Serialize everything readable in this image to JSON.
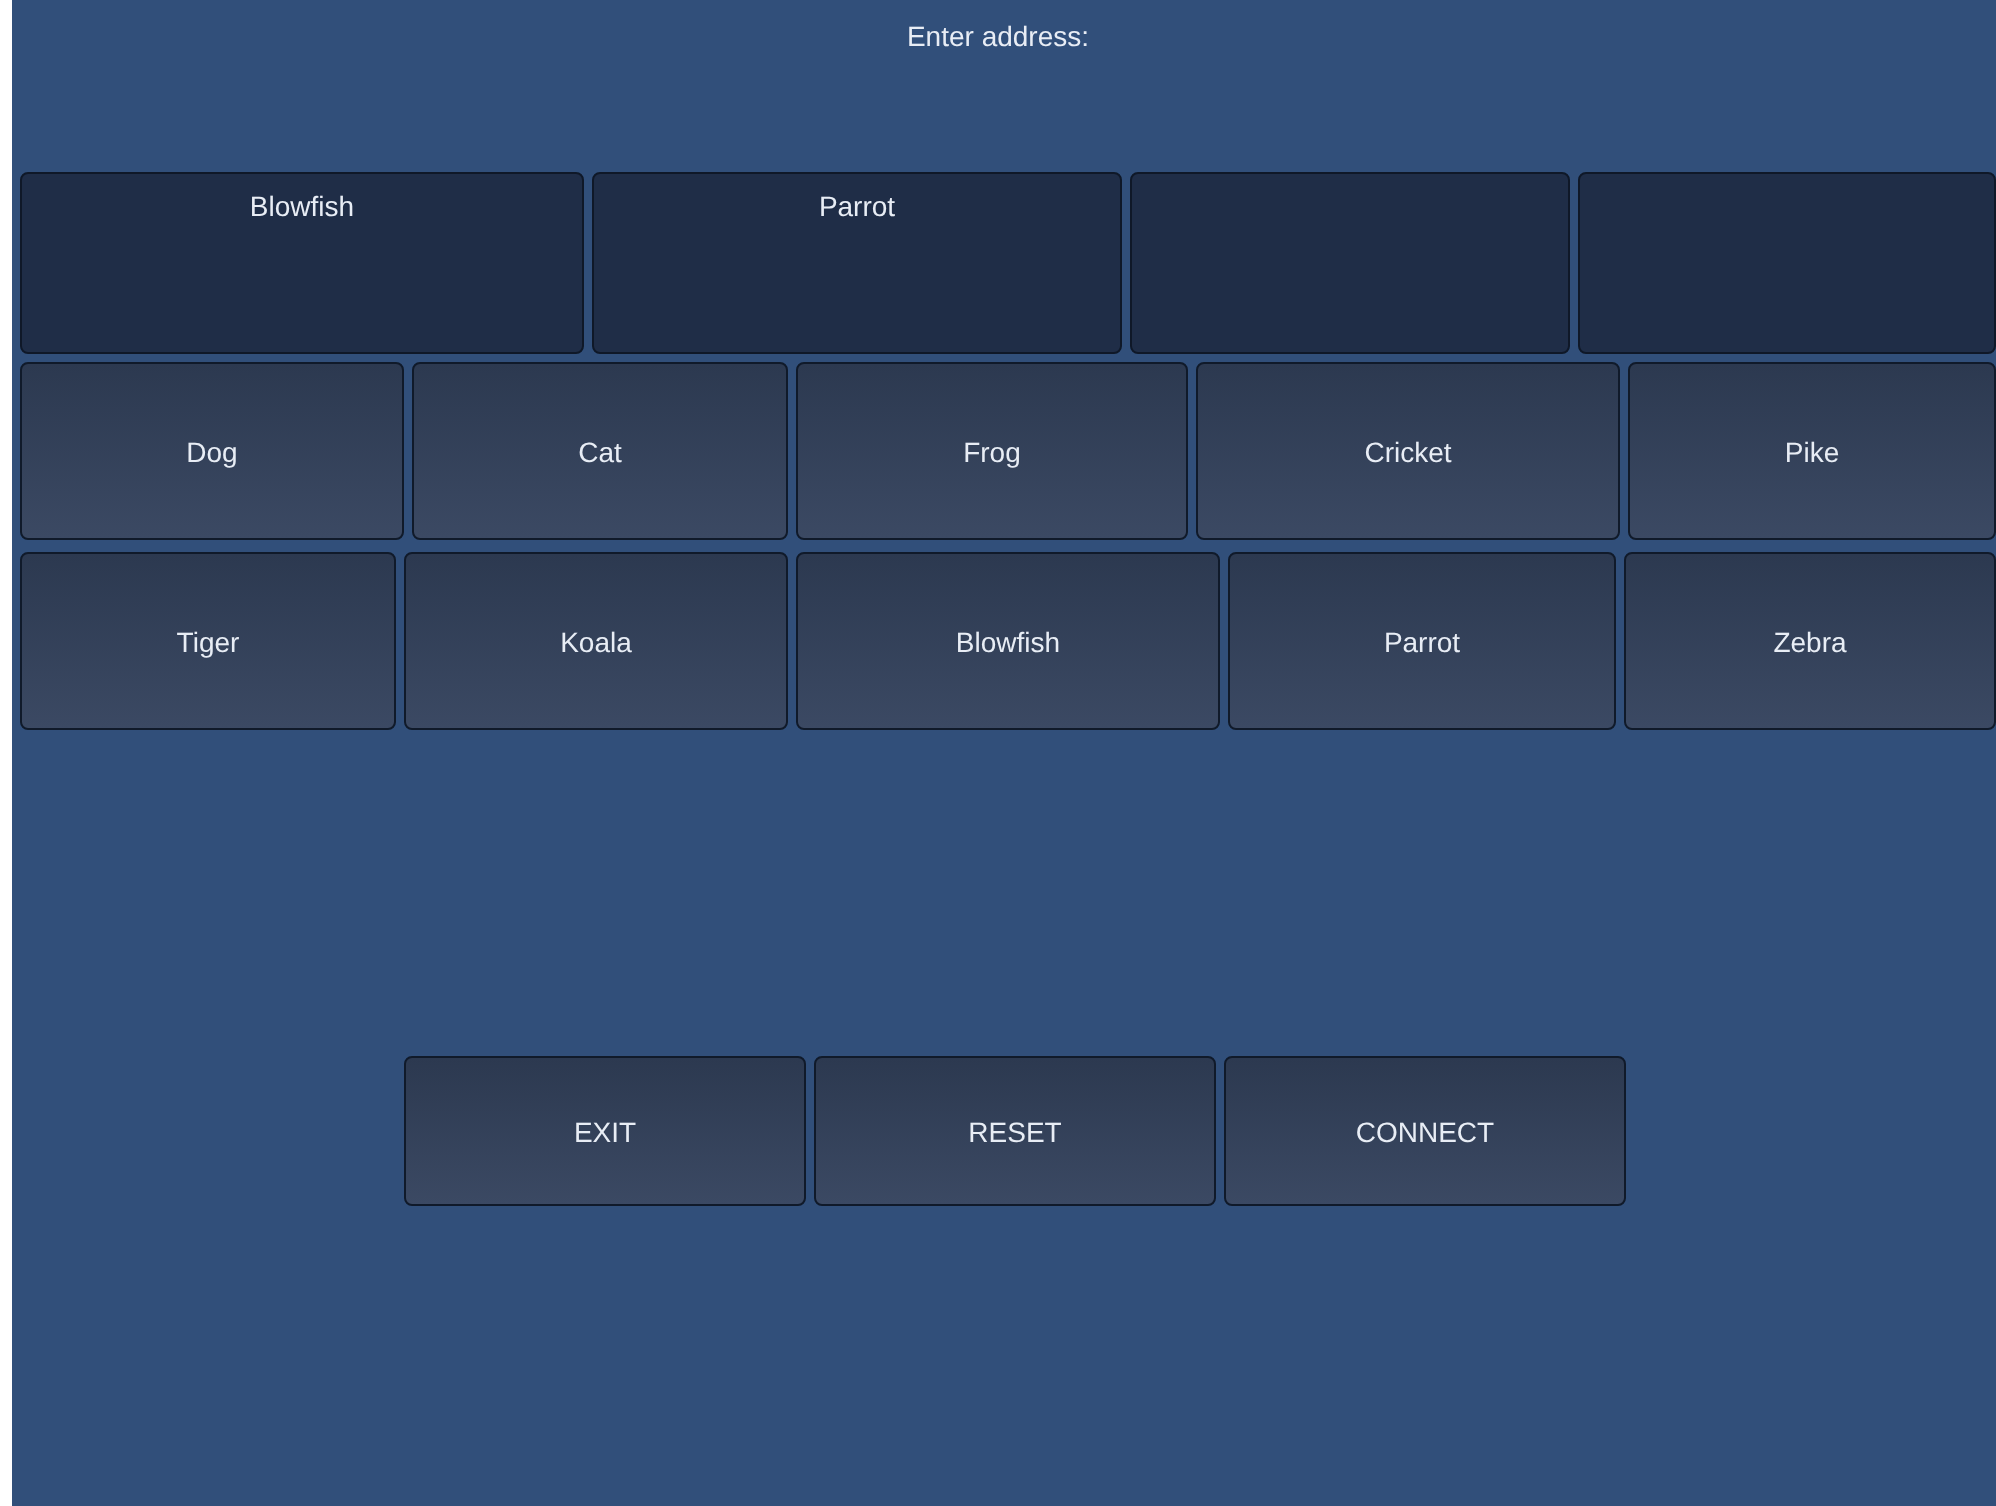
{
  "prompt": "Enter address:",
  "address_entries": [
    "Blowfish",
    "Parrot"
  ],
  "keys": [
    [
      "Dog",
      "Cat",
      "Frog",
      "Cricket",
      "Pike"
    ],
    [
      "Tiger",
      "Koala",
      "Blowfish",
      "Parrot",
      "Zebra"
    ]
  ],
  "buttons": [
    "EXIT",
    "RESET",
    "CONNECT"
  ]
}
